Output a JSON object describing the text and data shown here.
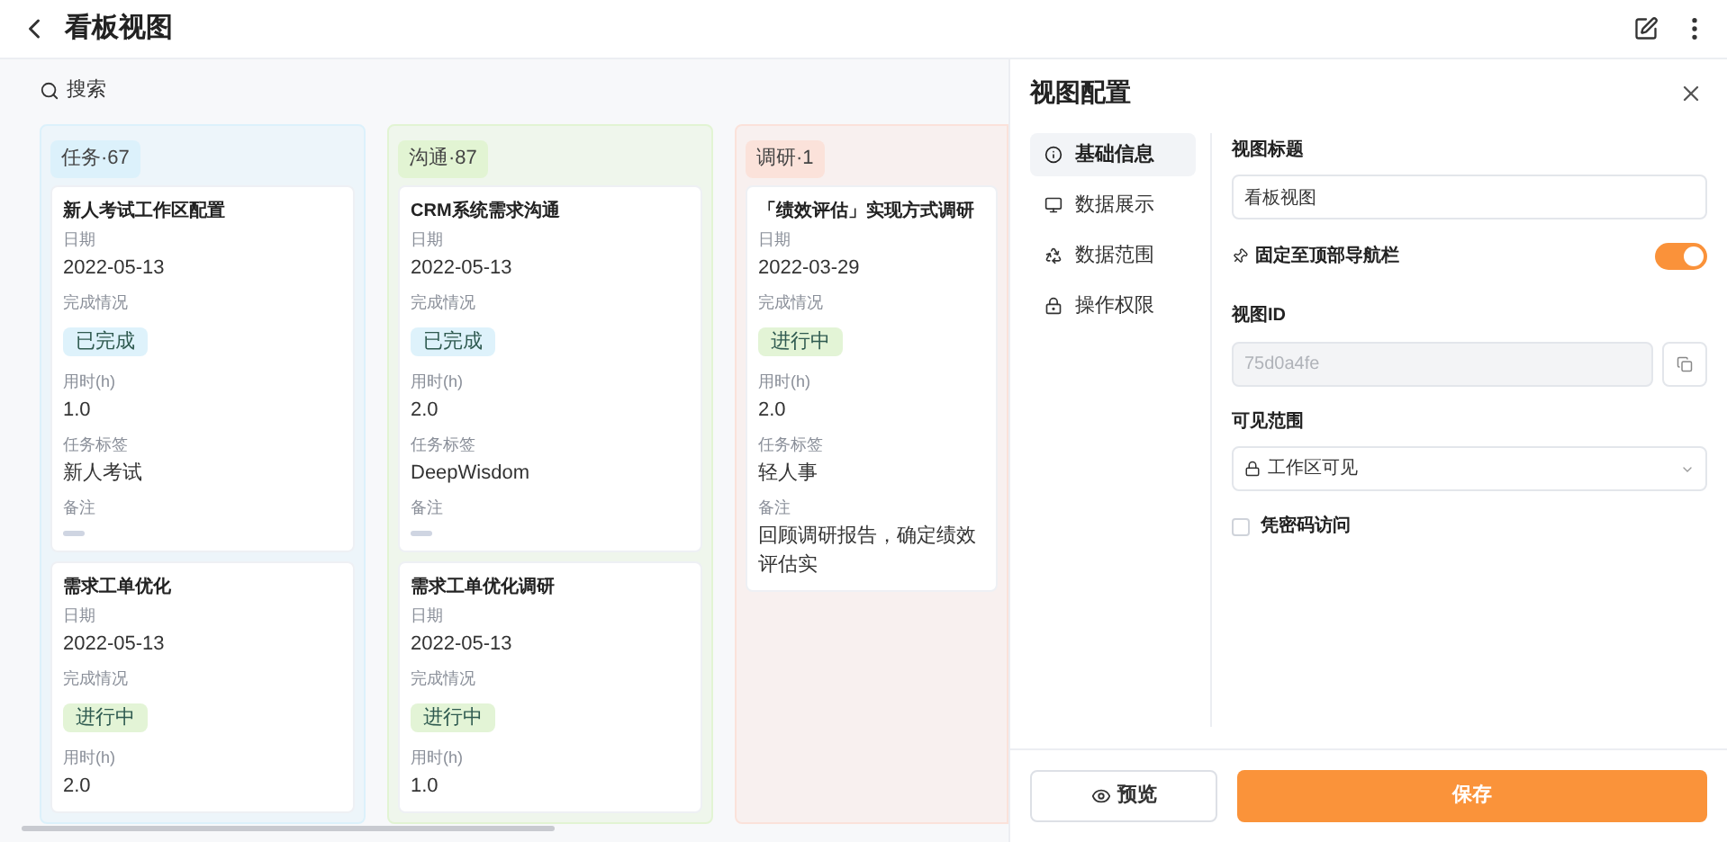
{
  "header": {
    "title": "看板视图"
  },
  "search": {
    "placeholder": "搜索"
  },
  "columns": [
    {
      "title": "任务·67",
      "color": "#dcf1fb",
      "cards": [
        {
          "title": "新人考试工作区配置",
          "fields": [
            {
              "label": "日期",
              "kind": "text",
              "value": "2022-05-13"
            },
            {
              "label": "完成情况",
              "kind": "status",
              "value": "已完成",
              "color": "#def2fb"
            },
            {
              "label": "用时(h)",
              "kind": "text",
              "value": "1.0"
            },
            {
              "label": "任务标签",
              "kind": "text",
              "value": "新人考试"
            },
            {
              "label": "备注",
              "kind": "empty"
            }
          ]
        },
        {
          "title": "需求工单优化",
          "fields": [
            {
              "label": "日期",
              "kind": "text",
              "value": "2022-05-13"
            },
            {
              "label": "完成情况",
              "kind": "status",
              "value": "进行中",
              "color": "#e3f4d6"
            },
            {
              "label": "用时(h)",
              "kind": "text",
              "value": "2.0"
            }
          ]
        }
      ]
    },
    {
      "title": "沟通·87",
      "color": "#e2f4d3",
      "cards": [
        {
          "title": "CRM系统需求沟通",
          "fields": [
            {
              "label": "日期",
              "kind": "text",
              "value": "2022-05-13"
            },
            {
              "label": "完成情况",
              "kind": "status",
              "value": "已完成",
              "color": "#def2fb"
            },
            {
              "label": "用时(h)",
              "kind": "text",
              "value": "2.0"
            },
            {
              "label": "任务标签",
              "kind": "text",
              "value": "DeepWisdom"
            },
            {
              "label": "备注",
              "kind": "empty"
            }
          ]
        },
        {
          "title": "需求工单优化调研",
          "fields": [
            {
              "label": "日期",
              "kind": "text",
              "value": "2022-05-13"
            },
            {
              "label": "完成情况",
              "kind": "status",
              "value": "进行中",
              "color": "#e3f4d6"
            },
            {
              "label": "用时(h)",
              "kind": "text",
              "value": "1.0"
            }
          ]
        }
      ]
    },
    {
      "title": "调研·1",
      "color": "#fbe2da",
      "cards": [
        {
          "title": "「绩效评估」实现方式调研",
          "fields": [
            {
              "label": "日期",
              "kind": "text",
              "value": "2022-03-29"
            },
            {
              "label": "完成情况",
              "kind": "status",
              "value": "进行中",
              "color": "#e3f4d6"
            },
            {
              "label": "用时(h)",
              "kind": "text",
              "value": "2.0"
            },
            {
              "label": "任务标签",
              "kind": "text",
              "value": "轻人事"
            },
            {
              "label": "备注",
              "kind": "text",
              "value": "回顾调研报告，确定绩效评估实"
            }
          ]
        }
      ]
    }
  ],
  "panel": {
    "title": "视图配置",
    "nav": [
      {
        "label": "基础信息",
        "selected": true
      },
      {
        "label": "数据展示",
        "selected": false
      },
      {
        "label": "数据范围",
        "selected": false
      },
      {
        "label": "操作权限",
        "selected": false
      }
    ],
    "view_title": {
      "label": "视图标题",
      "value": "看板视图"
    },
    "pin": {
      "label": "固定至顶部导航栏",
      "on": true
    },
    "view_id": {
      "label": "视图ID",
      "value": "75d0a4fe"
    },
    "visibility": {
      "label": "可见范围",
      "value": "工作区可见"
    },
    "password": {
      "label": "凭密码访问",
      "checked": false
    },
    "buttons": {
      "preview": "预览",
      "save": "保存"
    }
  }
}
